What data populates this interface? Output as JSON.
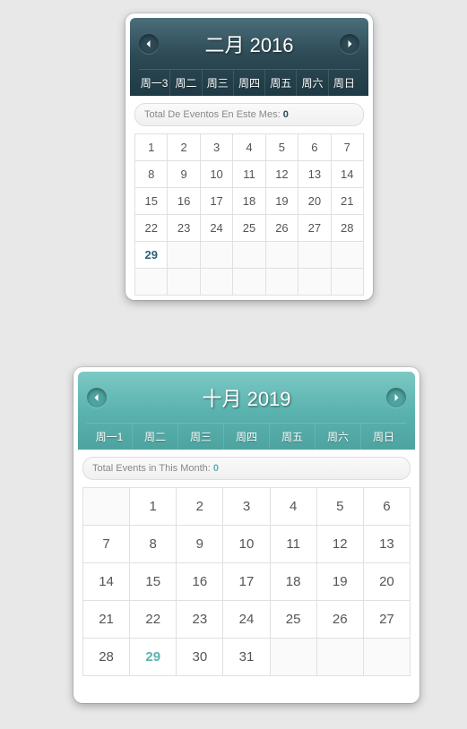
{
  "cal1": {
    "title": "二月 2016",
    "weekdays": [
      "周一3",
      "周二",
      "周三",
      "周四",
      "周五",
      "周六",
      "周日"
    ],
    "summary_label": "Total De Eventos En Este Mes: ",
    "summary_count": "0",
    "first_day_offset": 0,
    "days_in_month": 29,
    "today": 29,
    "trailing_rows": 1
  },
  "cal2": {
    "title": "十月 2019",
    "weekdays": [
      "周一1",
      "周二",
      "周三",
      "周四",
      "周五",
      "周六",
      "周日"
    ],
    "summary_label": "Total Events in This Month: ",
    "summary_count": "0",
    "first_day_offset": 1,
    "days_in_month": 31,
    "today": 29,
    "trailing_rows": 0
  }
}
